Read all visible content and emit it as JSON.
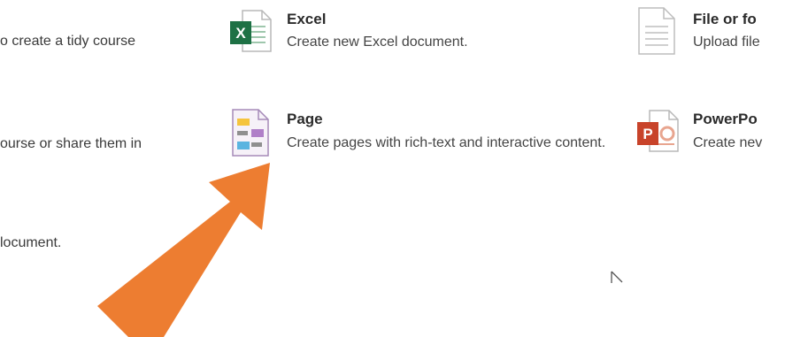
{
  "left_column": {
    "line1": "o create a tidy course",
    "line2": "ourse or share them in",
    "line3": "locument."
  },
  "tiles": {
    "excel": {
      "icon": "excel-icon",
      "title": "Excel",
      "description": "Create new Excel document."
    },
    "page": {
      "icon": "page-icon",
      "title": "Page",
      "description": "Create pages with rich-text and interactive content."
    },
    "file": {
      "icon": "file-icon",
      "title": "File or fo",
      "description": "Upload file"
    },
    "powerpoint": {
      "icon": "powerpoint-icon",
      "title": "PowerPo",
      "description": "Create nev"
    }
  },
  "colors": {
    "excel_green": "#1e7145",
    "powerpoint_red": "#c8432a",
    "arrow_orange": "#ed7d31",
    "text": "#3a3a3a"
  },
  "overlay": {
    "arrow_icon": "orange-arrow-icon",
    "cursor_icon": "mouse-cursor-icon"
  }
}
